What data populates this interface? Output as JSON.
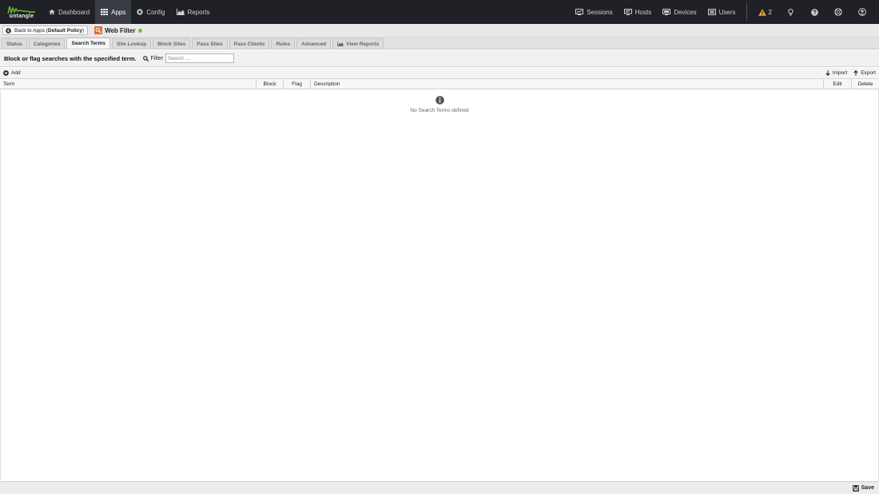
{
  "brand": {
    "logo_text": "untangle",
    "accent": "#6bc13a"
  },
  "nav": {
    "left": [
      {
        "label": "Dashboard",
        "icon": "home-icon"
      },
      {
        "label": "Apps",
        "icon": "grid-icon",
        "active": true
      },
      {
        "label": "Config",
        "icon": "gear-icon"
      },
      {
        "label": "Reports",
        "icon": "chart-icon"
      }
    ],
    "right": [
      {
        "label": "Sessions",
        "icon": "sessions-icon"
      },
      {
        "label": "Hosts",
        "icon": "hosts-icon"
      },
      {
        "label": "Devices",
        "icon": "devices-icon"
      },
      {
        "label": "Users",
        "icon": "users-icon"
      }
    ],
    "alert_count": "2"
  },
  "app_header": {
    "back_prefix": "Back to Apps (",
    "back_policy": "Default Policy",
    "back_suffix": ")",
    "app_name": "Web Filter",
    "status_color": "#6bc13a"
  },
  "tabs": [
    {
      "label": "Status"
    },
    {
      "label": "Categories"
    },
    {
      "label": "Search Terms",
      "active": true
    },
    {
      "label": "Site Lookup"
    },
    {
      "label": "Block Sites"
    },
    {
      "label": "Pass Sites"
    },
    {
      "label": "Pass Clients"
    },
    {
      "label": "Rules"
    },
    {
      "label": "Advanced"
    },
    {
      "label": "View Reports",
      "icon": "chart-icon"
    }
  ],
  "description": "Block or flag searches with the specified term.",
  "filter": {
    "label": "Filter",
    "placeholder": "Search ..."
  },
  "toolbar": {
    "add_label": "Add",
    "import_label": "Import",
    "export_label": "Export"
  },
  "grid": {
    "columns": [
      "Term",
      "Block",
      "Flag",
      "Description",
      "Edit",
      "Delete"
    ],
    "empty_text": "No Search Terms defined"
  },
  "footer": {
    "save_label": "Save"
  }
}
